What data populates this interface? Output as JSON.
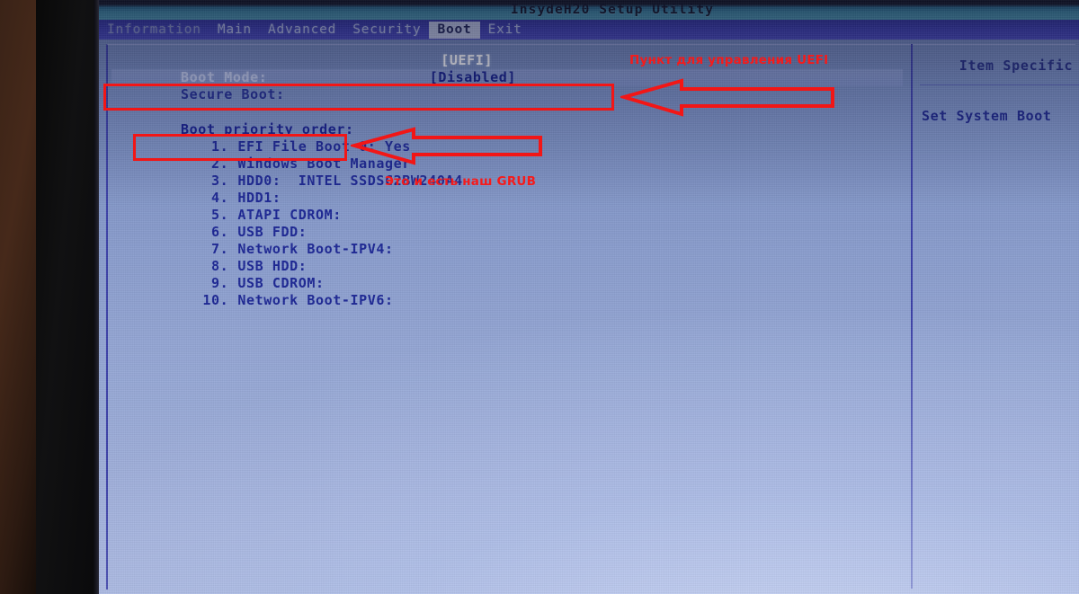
{
  "window": {
    "title": "InsydeH20 Setup Utility"
  },
  "menu": {
    "items": [
      {
        "label": "Information",
        "active": false
      },
      {
        "label": "Main",
        "active": false
      },
      {
        "label": "Advanced",
        "active": false
      },
      {
        "label": "Security",
        "active": false
      },
      {
        "label": "Boot",
        "active": true
      },
      {
        "label": "Exit",
        "active": false
      }
    ]
  },
  "settings": {
    "boot_mode": {
      "label": "Boot Mode:",
      "value": "[UEFI]"
    },
    "secure_boot": {
      "label": "Secure Boot:",
      "value": "[Disabled]",
      "selected": true
    }
  },
  "boot_priority": {
    "heading": "Boot priority order:",
    "items": [
      {
        "num": "1.",
        "label": "EFI File Boot 0: Yes"
      },
      {
        "num": "2.",
        "label": "Windows Boot Manager"
      },
      {
        "num": "3.",
        "label": "HDD0:  INTEL SSDSC2BW240A4"
      },
      {
        "num": "4.",
        "label": "HDD1:"
      },
      {
        "num": "5.",
        "label": "ATAPI CDROM:"
      },
      {
        "num": "6.",
        "label": "USB FDD:"
      },
      {
        "num": "7.",
        "label": "Network Boot-IPV4:"
      },
      {
        "num": "8.",
        "label": "USB HDD:"
      },
      {
        "num": "9.",
        "label": "USB CDROM:"
      },
      {
        "num": "10.",
        "label": "Network Boot-IPV6:"
      }
    ]
  },
  "help_pane": {
    "title": "Item Specific",
    "body": "Set System Boot"
  },
  "annotations": {
    "uefi_note": "Пункт для управления UEFI",
    "grub_note": "Это и есть наш GRUB",
    "color": "#f21616"
  }
}
